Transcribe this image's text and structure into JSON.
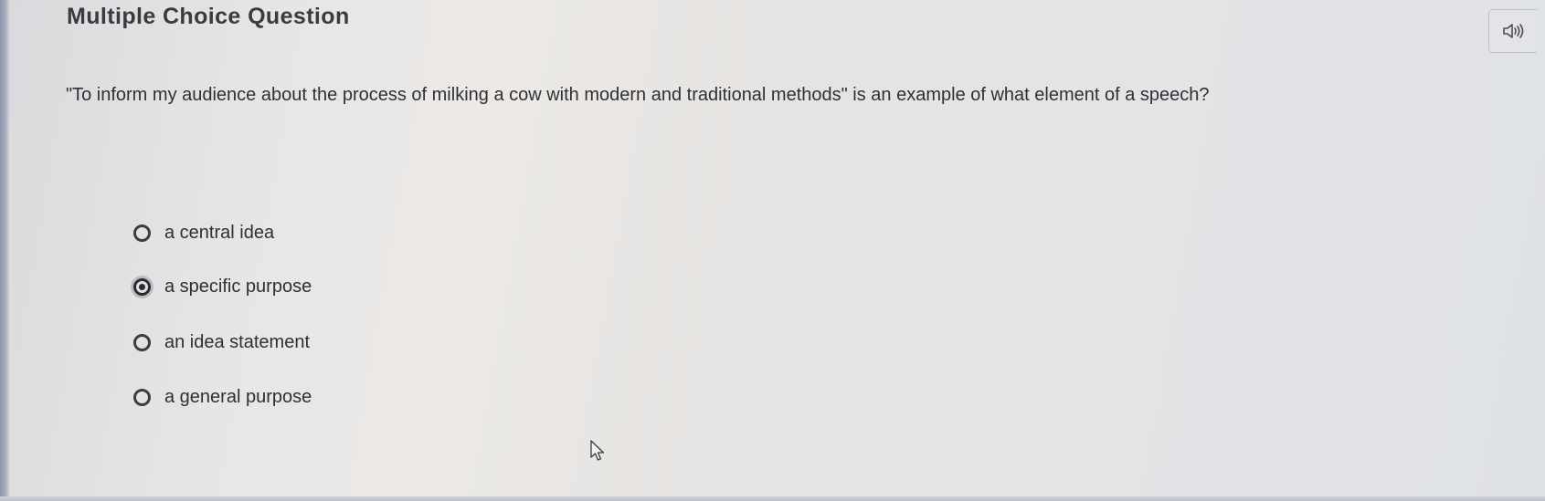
{
  "question_panel": {
    "title": "Multiple Choice Question",
    "question_text": "\"To inform my audience about the process of milking a cow with modern and traditional methods\" is an example of what element of a speech?",
    "audio_button_icon": "speaker-icon",
    "options": [
      {
        "label": "a central idea",
        "selected": false
      },
      {
        "label": "a specific purpose",
        "selected": true
      },
      {
        "label": "an idea statement",
        "selected": false
      },
      {
        "label": "a general purpose",
        "selected": false
      }
    ]
  },
  "colors": {
    "text": "#2f3033",
    "radio_border": "#3c3d40",
    "background": "#e6e4e2"
  }
}
